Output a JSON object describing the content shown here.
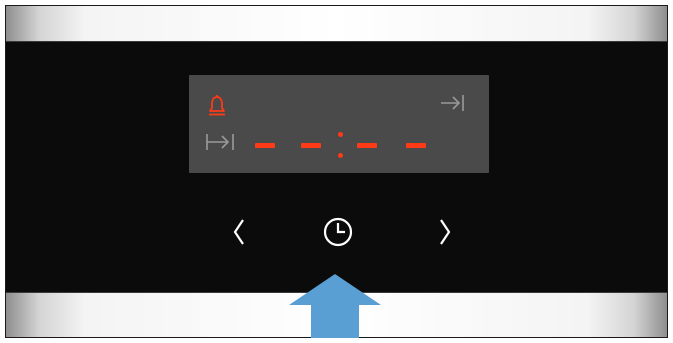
{
  "display": {
    "time_value": "--:--",
    "indicator_color": "#ff3a16",
    "icons": [
      "alarm-bell-icon",
      "end-time-icon",
      "start-time-icon"
    ]
  },
  "controls": {
    "left_button_icon": "chevron-left-icon",
    "timer_button_icon": "clock-icon",
    "right_button_icon": "chevron-right-icon"
  },
  "annotation": {
    "icon": "arrow-up-icon",
    "color": "#5a9fd4"
  },
  "colors": {
    "panel": "#0b0b0b",
    "display": "#4a4a4a",
    "indicator": "#ff3a16",
    "symbols": "#ffffff",
    "arrow": "#5a9fd4"
  }
}
